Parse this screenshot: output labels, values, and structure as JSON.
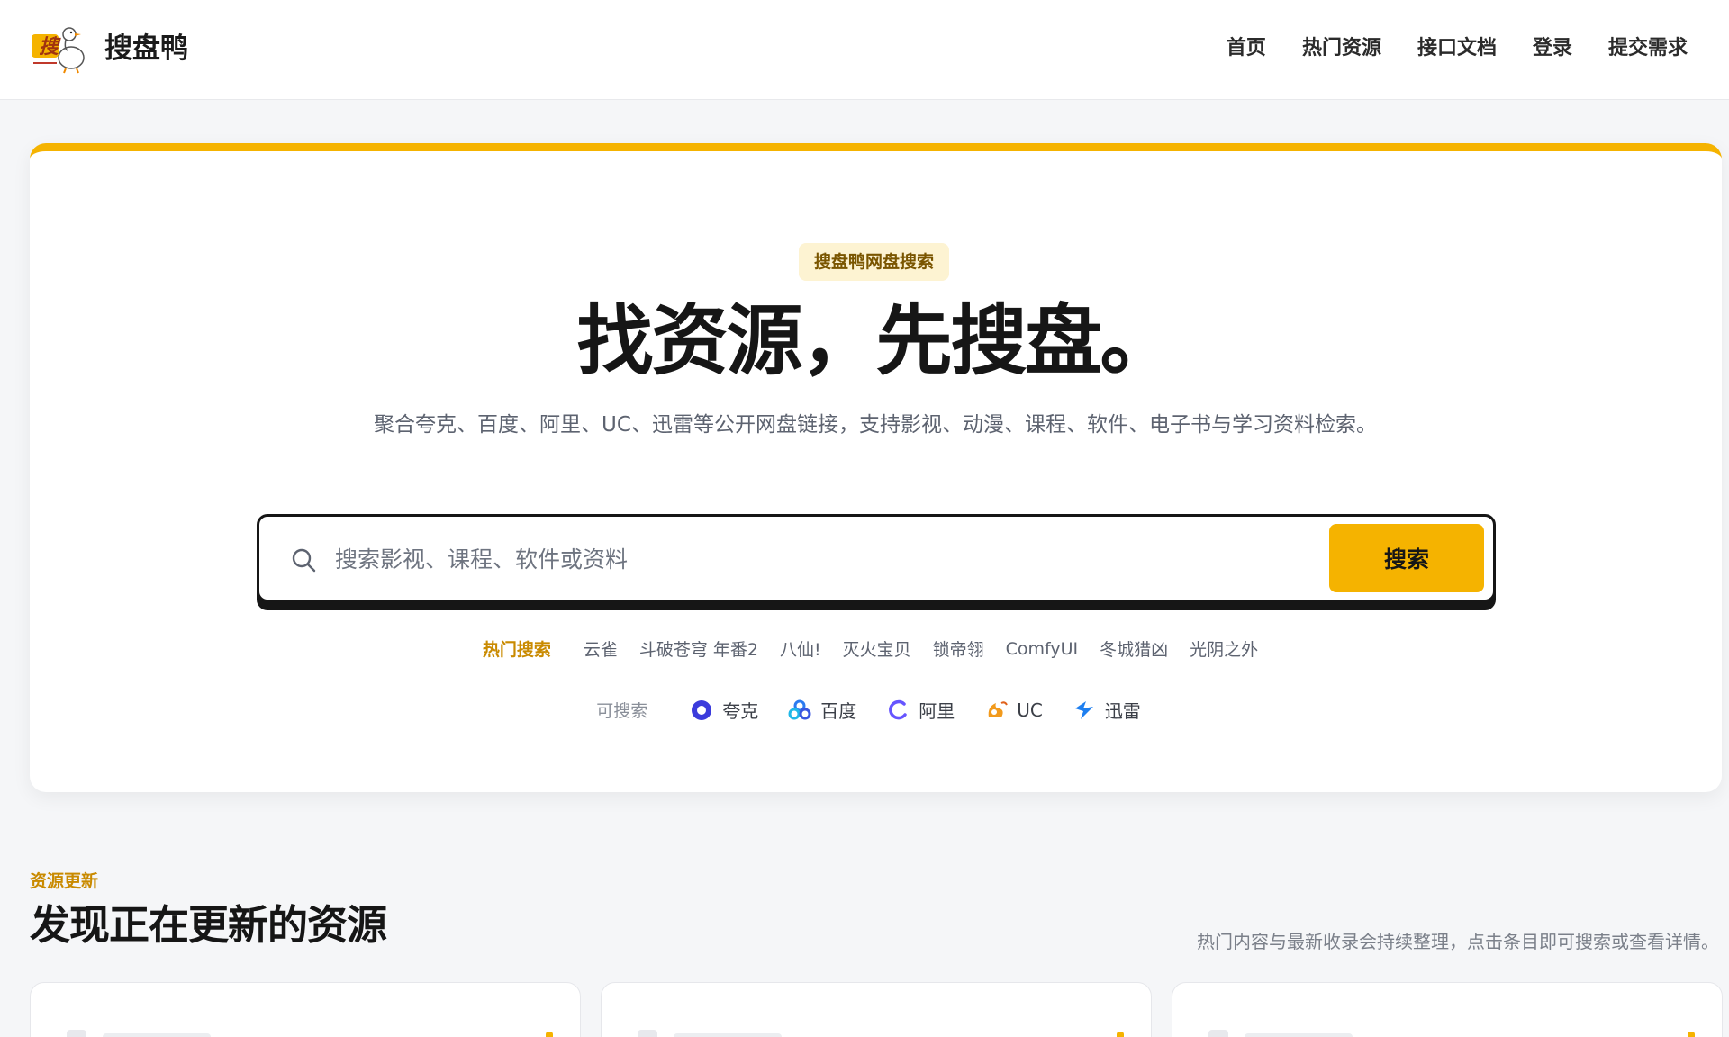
{
  "header": {
    "brand": "搜盘鸭",
    "logo_icon": "duck-search-logo-icon",
    "nav": [
      {
        "label": "首页"
      },
      {
        "label": "热门资源"
      },
      {
        "label": "接口文档"
      },
      {
        "label": "登录"
      },
      {
        "label": "提交需求"
      }
    ]
  },
  "hero": {
    "badge": "搜盘鸭网盘搜索",
    "title": "找资源，先搜盘。",
    "subtitle": "聚合夸克、百度、阿里、UC、迅雷等公开网盘链接，支持影视、动漫、课程、软件、电子书与学习资料检索。",
    "search": {
      "placeholder": "搜索影视、课程、软件或资料",
      "value": "",
      "button_label": "搜索"
    },
    "hot_label": "热门搜索",
    "hot_items": [
      "云雀",
      "斗破苍穹 年番2",
      "八仙!",
      "灭火宝贝",
      "锁帝翎",
      "ComfyUI",
      "冬城猎凶",
      "光阴之外"
    ],
    "source_label": "可搜索",
    "sources": [
      {
        "name": "夸克",
        "icon": "quark-icon",
        "color": "#3b3bdc"
      },
      {
        "name": "百度",
        "icon": "baidu-pan-icon",
        "color": "#2b7bf0"
      },
      {
        "name": "阿里",
        "icon": "aliyun-pan-icon",
        "color": "#6655ff"
      },
      {
        "name": "UC",
        "icon": "uc-icon",
        "color": "#f29a1c"
      },
      {
        "name": "迅雷",
        "icon": "xunlei-icon",
        "color": "#1e7ff0"
      }
    ]
  },
  "updates": {
    "tag": "资源更新",
    "title": "发现正在更新的资源",
    "description": "热门内容与最新收录会持续整理，点击条目即可搜索或查看详情。"
  },
  "colors": {
    "accent": "#f5b300",
    "text": "#161616",
    "muted": "#5d6370"
  }
}
